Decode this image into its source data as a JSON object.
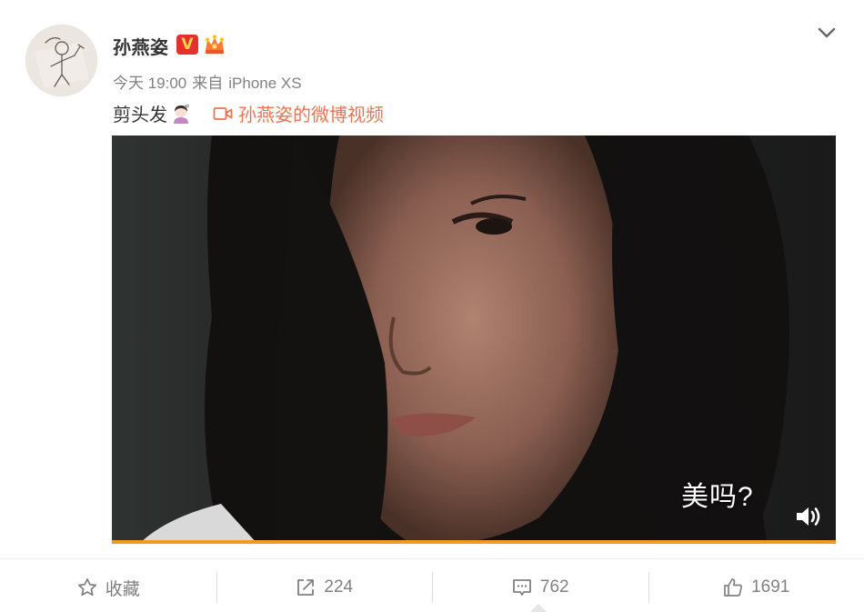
{
  "post": {
    "author_name": "孙燕姿",
    "verified_badge": "V",
    "crown_icon": "crown-icon",
    "time": "今天 19:00",
    "source_prefix": "来自",
    "source_device": "iPhone XS",
    "text": "剪头发",
    "emoji": "haircut-emoji",
    "video_link_label": "孙燕姿的微博视频"
  },
  "video": {
    "caption": "美吗?",
    "progress_percent": 100,
    "muted": false
  },
  "actions": {
    "favorite_label": "收藏",
    "repost_count": "224",
    "comment_count": "762",
    "like_count": "1691"
  },
  "colors": {
    "link": "#eb7350",
    "badge_bg": "#e6302d",
    "progress": "#f29a1f",
    "muted_text": "#808080"
  }
}
